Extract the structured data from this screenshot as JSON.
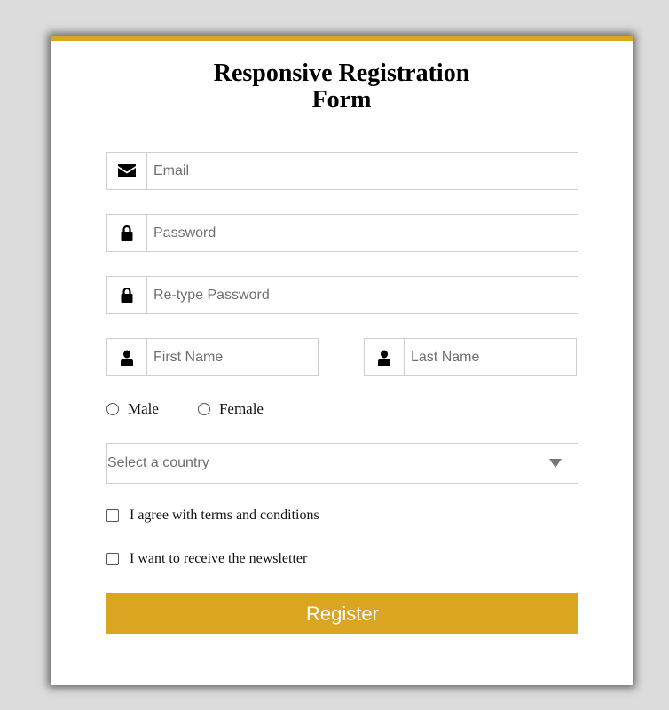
{
  "form": {
    "title_line1": "Responsive Registration",
    "title_line2": "Form",
    "email": {
      "placeholder": "Email",
      "value": "",
      "icon": "envelope-icon"
    },
    "password": {
      "placeholder": "Password",
      "value": "",
      "icon": "lock-icon"
    },
    "retype_password": {
      "placeholder": "Re-type Password",
      "value": "",
      "icon": "lock-icon"
    },
    "first_name": {
      "placeholder": "First Name",
      "value": "",
      "icon": "user-icon"
    },
    "last_name": {
      "placeholder": "Last Name",
      "value": "",
      "icon": "user-icon"
    },
    "gender": {
      "options": [
        {
          "label": "Male",
          "selected": false
        },
        {
          "label": "Female",
          "selected": false
        }
      ]
    },
    "country": {
      "selected": "Select a country"
    },
    "terms_label": "I agree with terms and conditions",
    "newsletter_label": "I want to receive the newsletter",
    "register_label": "Register"
  },
  "colors": {
    "accent": "#daa520",
    "background": "#dcdcdc",
    "card": "#ffffff",
    "border": "#cfcfcf"
  }
}
